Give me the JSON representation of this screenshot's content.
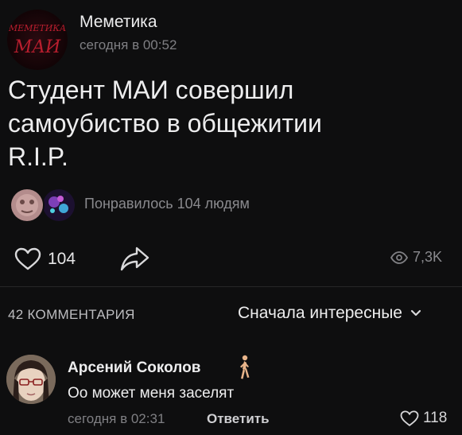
{
  "post": {
    "group_name": "Меметика",
    "time": "сегодня в 00:52",
    "text": "Студент МАИ совершил\nсамоубиство в общежитии\nR.I.P.",
    "avatar_logo_top": "МЕМЕТИКА",
    "avatar_logo_bottom": "МАИ",
    "likes_summary": "Понравилось 104 людям",
    "like_count": "104",
    "views": "7,3K"
  },
  "comments_header": {
    "count_label": "42 КОММЕНТАРИЯ",
    "sort_label": "Сначала интересные"
  },
  "comment": {
    "author": "Арсений Соколов",
    "text": "Оо может меня заселят",
    "time": "сегодня в 02:31",
    "reply_label": "Ответить",
    "like_count": "118"
  },
  "icons": {
    "like": "heart-outline-icon",
    "share": "share-arrow-icon",
    "views": "eye-icon",
    "sort": "chevron-down-icon",
    "name_emoji": "person-walking-icon"
  },
  "colors": {
    "background": "#0e0e0f",
    "text_primary": "#ededee",
    "text_secondary": "#7f7f83",
    "avatar_logo": "#b81e2e"
  }
}
